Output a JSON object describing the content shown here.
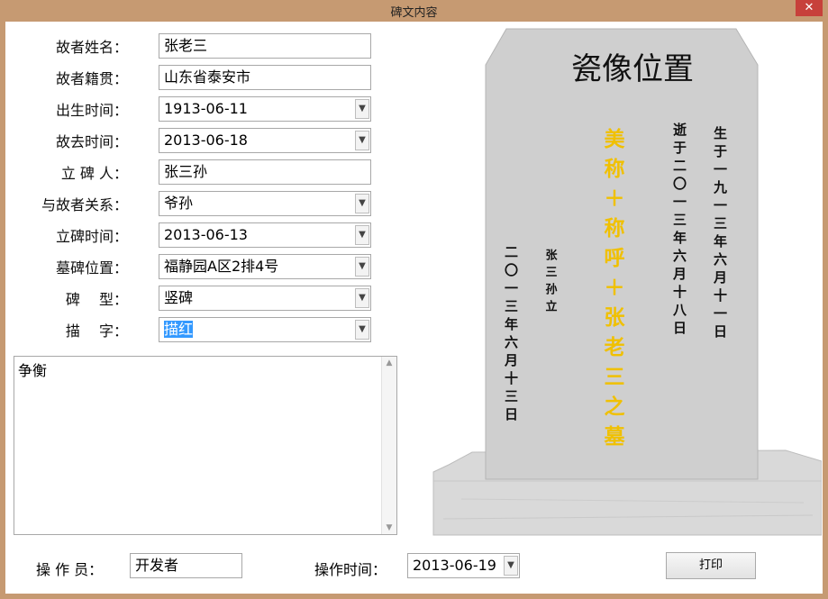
{
  "window": {
    "title": "碑文内容",
    "close_glyph": "✕"
  },
  "form": {
    "deceased_name": {
      "label": "故者姓名：",
      "value": "张老三"
    },
    "native_place": {
      "label": "故者籍贯：",
      "value": "山东省泰安市"
    },
    "birth_date": {
      "label": "出生时间：",
      "value": "1913-06-11"
    },
    "death_date": {
      "label": "故去时间：",
      "value": "2013-06-18"
    },
    "erector": {
      "label": "立 碑 人：",
      "value": "张三孙"
    },
    "relation": {
      "label": "与故者关系：",
      "value": "爷孙"
    },
    "erect_date": {
      "label": "立碑时间：",
      "value": "2013-06-13"
    },
    "tomb_location": {
      "label": "墓碑位置：",
      "value": "福静园A区2排4号"
    },
    "tomb_type": {
      "label": "碑　 型：",
      "value": "竖碑"
    },
    "lettering": {
      "label": "描　 字：",
      "value": "描红"
    },
    "notes": "争衡"
  },
  "footer": {
    "operator_label": "操 作 员：",
    "operator_value": "开发者",
    "op_time_label": "操作时间：",
    "op_time_value": "2013-06-19",
    "print_label": "打印"
  },
  "tombstone": {
    "photo_label": "瓷像位置",
    "center_text": "美称＋称呼＋张老三之墓",
    "birth_text": "生于一九一三年六月十一日",
    "death_text": "逝于二〇一三年六月十八日",
    "erector_text": "张三孙立",
    "erect_date_text": "二〇一三年六月十三日",
    "colors": {
      "stone": "#cfcfcf",
      "gold": "#f0c000",
      "ink": "#111111",
      "base": "#dcdcdc"
    }
  },
  "icons": {
    "dropdown": "chevron-down-icon",
    "scroll_up": "scroll-up-icon",
    "scroll_down": "scroll-down-icon"
  }
}
